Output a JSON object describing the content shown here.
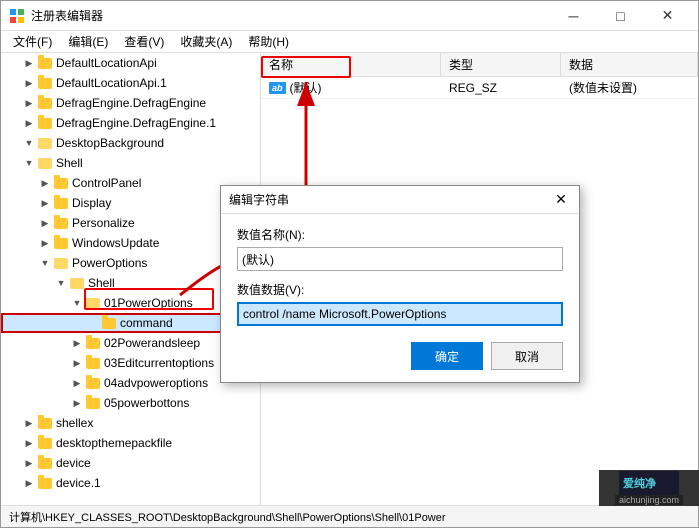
{
  "window": {
    "title": "注册表编辑器",
    "icon": "regedit-icon"
  },
  "menu": {
    "items": [
      "文件(F)",
      "编辑(E)",
      "查看(V)",
      "收藏夹(A)",
      "帮助(H)"
    ]
  },
  "tree": {
    "nodes": [
      {
        "id": "DefaultLocationApi",
        "label": "DefaultLocationApi",
        "indent": 1,
        "expanded": false
      },
      {
        "id": "DefaultLocationApi1",
        "label": "DefaultLocationApi.1",
        "indent": 1,
        "expanded": false
      },
      {
        "id": "DefragEngine",
        "label": "DefragEngine.DefragEngine",
        "indent": 1,
        "expanded": false
      },
      {
        "id": "DefragEngine1",
        "label": "DefragEngine.DefragEngine.1",
        "indent": 1,
        "expanded": false
      },
      {
        "id": "DesktopBackground",
        "label": "DesktopBackground",
        "indent": 1,
        "expanded": true
      },
      {
        "id": "Shell",
        "label": "Shell",
        "indent": 2,
        "expanded": true,
        "selected": false
      },
      {
        "id": "ControlPanel",
        "label": "ControlPanel",
        "indent": 3,
        "expanded": false
      },
      {
        "id": "Display",
        "label": "Display",
        "indent": 3,
        "expanded": false
      },
      {
        "id": "Personalize",
        "label": "Personalize",
        "indent": 3,
        "expanded": false
      },
      {
        "id": "WindowsUpdate",
        "label": "WindowsUpdate",
        "indent": 3,
        "expanded": false
      },
      {
        "id": "PowerOptions",
        "label": "PowerOptions",
        "indent": 3,
        "expanded": true
      },
      {
        "id": "Shell2",
        "label": "Shell",
        "indent": 4,
        "expanded": true
      },
      {
        "id": "01PowerOptions",
        "label": "01PowerOptions",
        "indent": 5,
        "expanded": true
      },
      {
        "id": "command",
        "label": "command",
        "indent": 6,
        "expanded": false,
        "selected": true,
        "highlighted": true
      },
      {
        "id": "02Powerandsleep",
        "label": "02Powerandsleep",
        "indent": 5,
        "expanded": false
      },
      {
        "id": "03Editcurrentoptions",
        "label": "03Editcurrentoptions",
        "indent": 5,
        "expanded": false
      },
      {
        "id": "04advpoweroptions",
        "label": "04advpoweroptions",
        "indent": 5,
        "expanded": false
      },
      {
        "id": "05powerbottons",
        "label": "05powerbottons",
        "indent": 5,
        "expanded": false
      },
      {
        "id": "shellex",
        "label": "shellex",
        "indent": 1,
        "expanded": false
      },
      {
        "id": "desktopthemepackfile",
        "label": "desktopthemepackfile",
        "indent": 1,
        "expanded": false
      },
      {
        "id": "device",
        "label": "device",
        "indent": 1,
        "expanded": false
      },
      {
        "id": "device1",
        "label": "device.1",
        "indent": 1,
        "expanded": false
      }
    ]
  },
  "columns": {
    "name": "名称",
    "type": "类型",
    "data": "数据"
  },
  "registry_data": [
    {
      "name": "(默认)",
      "icon": "ab",
      "type": "REG_SZ",
      "value": "(数值未设置)"
    }
  ],
  "dialog": {
    "title": "编辑字符串",
    "close_label": "✕",
    "name_label": "数值名称(N):",
    "name_value": "(默认)",
    "data_label": "数值数据(V):",
    "data_value": "control /name Microsoft.PowerOptions",
    "ok_label": "确定",
    "cancel_label": "取消"
  },
  "status_bar": {
    "text": "计算机\\HKEY_CLASSES_ROOT\\DesktopBackground\\Shell\\PowerOptions\\Shell\\01Power"
  },
  "watermark": {
    "text": "爱纯净",
    "url_text": "www.aichunjing.com"
  },
  "title_controls": {
    "minimize": "─",
    "maximize": "□",
    "close": "✕"
  }
}
